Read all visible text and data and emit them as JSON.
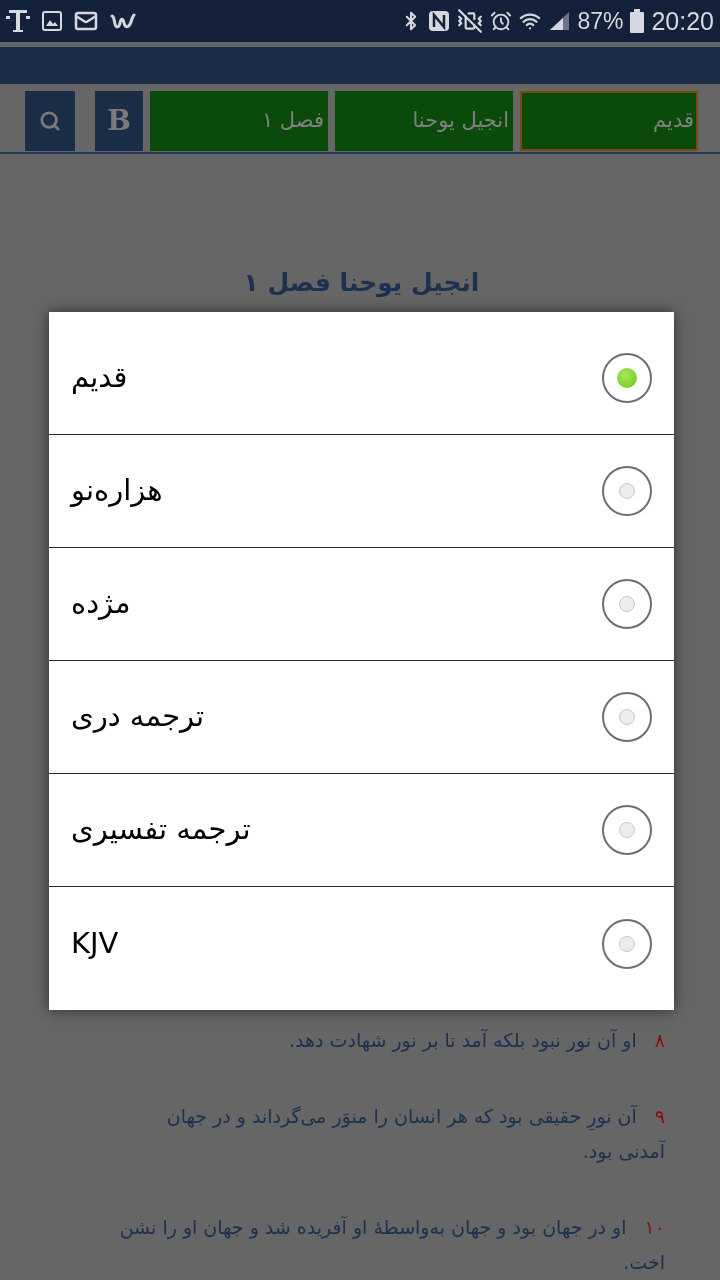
{
  "status_bar": {
    "battery_percent": "87%",
    "time": "20:20"
  },
  "toolbar": {
    "selectors": [
      {
        "label": "قدیم",
        "active": true
      },
      {
        "label": "انجیل یوحنا",
        "active": false
      },
      {
        "label": "فصل ۱",
        "active": false
      }
    ],
    "letter_button": "B"
  },
  "page_title": "انجیل یوحنا فصل ۱",
  "dialog": {
    "options": [
      {
        "label": "قدیم",
        "selected": true
      },
      {
        "label": "هزاره‌نو",
        "selected": false
      },
      {
        "label": "مژده",
        "selected": false
      },
      {
        "label": "ترجمه دری",
        "selected": false
      },
      {
        "label": "ترجمه تفسیری",
        "selected": false
      },
      {
        "label": "KJV",
        "selected": false
      }
    ]
  },
  "verses": [
    {
      "number": "۸",
      "lines": [
        "او آن نور نبود بلکه آمد تا بر نور شهادت دهد."
      ]
    },
    {
      "number": "۹",
      "lines": [
        "آن نورِ حقیقی بود که هر انسان را منوَر می‌گرداند و در جهان",
        "آمدنی بود."
      ]
    },
    {
      "number": "۱۰",
      "lines": [
        "او در جهان بود و جهان به‌واسطهٔ او آفریده شد و جهان او را نشن",
        "اخت."
      ]
    }
  ]
}
